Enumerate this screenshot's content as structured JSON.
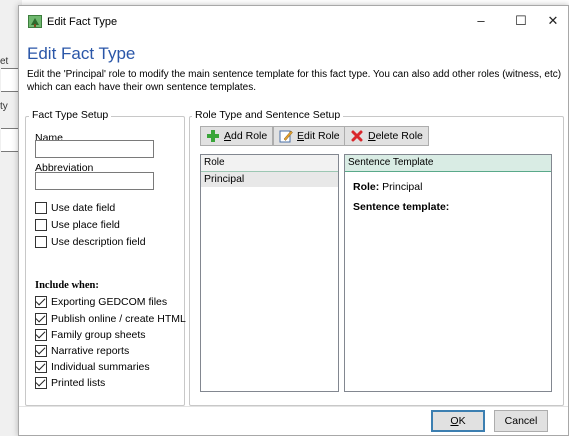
{
  "background": {
    "fragments": [
      "et",
      "ty"
    ]
  },
  "window": {
    "title": "Edit Fact Type",
    "icon": "tree-app-icon",
    "controls": {
      "minimize": "–",
      "maximize": "☐",
      "close": "✕"
    }
  },
  "heading": "Edit Fact Type",
  "description": "Edit the 'Principal' role to modify the main sentence template for this fact type.  You can also add other roles (witness, etc) which can each have their own sentence templates.",
  "fact_type_setup": {
    "title": "Fact Type Setup",
    "name_label": "Name",
    "name_value": "",
    "abbreviation_label": "Abbreviation",
    "abbreviation_value": "",
    "options": [
      {
        "label": "Use date field",
        "checked": false
      },
      {
        "label": "Use place field",
        "checked": false
      },
      {
        "label": "Use description field",
        "checked": false
      }
    ],
    "include_when_label": "Include when:",
    "include_when": [
      {
        "label": "Exporting GEDCOM files",
        "checked": true
      },
      {
        "label": "Publish online / create HTML",
        "checked": true
      },
      {
        "label": "Family group sheets",
        "checked": true
      },
      {
        "label": "Narrative reports",
        "checked": true
      },
      {
        "label": "Individual summaries",
        "checked": true
      },
      {
        "label": "Printed lists",
        "checked": true
      }
    ]
  },
  "role_setup": {
    "title": "Role Type and Sentence Setup",
    "toolbar": {
      "add_role": {
        "mnemonic": "A",
        "rest": "dd Role",
        "icon": "plus-icon"
      },
      "edit_role": {
        "mnemonic": "E",
        "rest": "dit Role",
        "icon": "edit-icon"
      },
      "delete_role": {
        "mnemonic": "D",
        "rest": "elete Role",
        "icon": "delete-x-icon"
      }
    },
    "role_list": {
      "header": "Role",
      "items": [
        "Principal"
      ]
    },
    "sentence": {
      "header": "Sentence Template",
      "role_label": "Role:",
      "role_value": "Principal",
      "template_label": "Sentence template:",
      "template_value": ""
    }
  },
  "footer": {
    "ok": {
      "mnemonic": "O",
      "rest": "K"
    },
    "cancel": "Cancel"
  },
  "colors": {
    "heading": "#2a56a8",
    "accent_green": "#5aa98a",
    "add_icon": "#3aa53a",
    "delete_icon": "#d9262b"
  }
}
